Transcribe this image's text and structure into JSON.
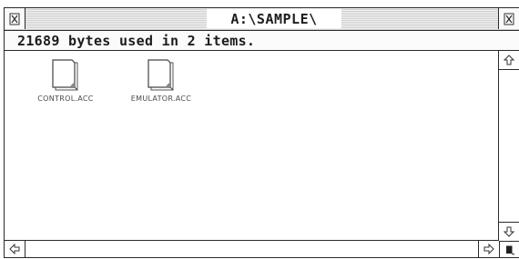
{
  "window": {
    "title": "A:\\SAMPLE\\",
    "info": "21689 bytes used in 2 items."
  },
  "files": [
    {
      "name": "CONTROL.ACC",
      "icon": "document-icon"
    },
    {
      "name": "EMULATOR.ACC",
      "icon": "document-icon"
    }
  ],
  "controls": {
    "closer_icon": "close-box-icon",
    "fuller_icon": "full-box-icon",
    "scroll_up_icon": "up-arrow-icon",
    "scroll_down_icon": "down-arrow-icon",
    "scroll_left_icon": "left-arrow-icon",
    "scroll_right_icon": "right-arrow-icon",
    "sizer_icon": "size-box-icon"
  }
}
